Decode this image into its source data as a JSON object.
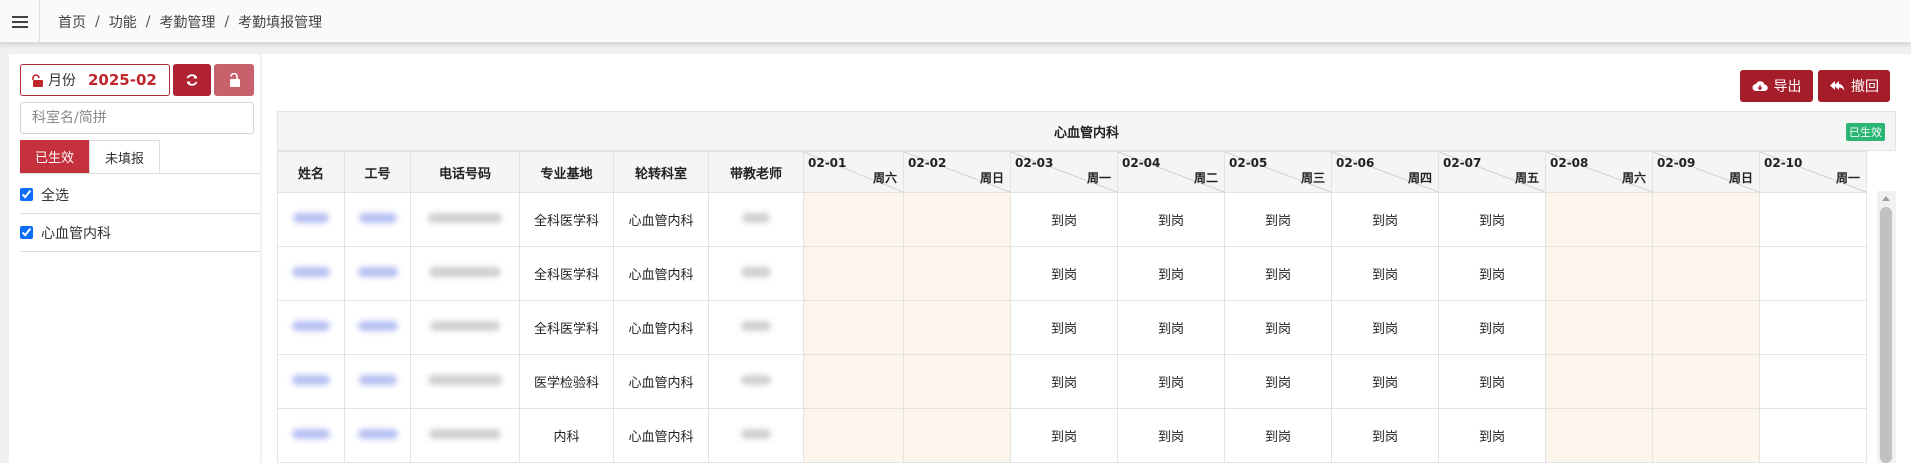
{
  "breadcrumb": [
    "首页",
    "功能",
    "考勤管理",
    "考勤填报管理"
  ],
  "filters": {
    "month_label": "月份",
    "month_value": "2025-02",
    "search_placeholder": "科室名/简拼",
    "tabs": [
      {
        "label": "已生效",
        "active": true
      },
      {
        "label": "未填报",
        "active": false
      }
    ],
    "dept_list": [
      {
        "label": "全选",
        "checked": true
      },
      {
        "label": "心血管内科",
        "checked": true
      }
    ]
  },
  "toolbar": {
    "export_label": "导出",
    "revoke_label": "撤回"
  },
  "table": {
    "title": "心血管内科",
    "status_badge": "已生效",
    "columns": [
      "姓名",
      "工号",
      "电话号码",
      "专业基地",
      "轮转科室",
      "带教老师"
    ],
    "dates": [
      {
        "date": "02-01",
        "weekday": "周六",
        "weekend": true
      },
      {
        "date": "02-02",
        "weekday": "周日",
        "weekend": true
      },
      {
        "date": "02-03",
        "weekday": "周一",
        "weekend": false
      },
      {
        "date": "02-04",
        "weekday": "周二",
        "weekend": false
      },
      {
        "date": "02-05",
        "weekday": "周三",
        "weekend": false
      },
      {
        "date": "02-06",
        "weekday": "周四",
        "weekend": false
      },
      {
        "date": "02-07",
        "weekday": "周五",
        "weekend": false
      },
      {
        "date": "02-08",
        "weekday": "周六",
        "weekend": true
      },
      {
        "date": "02-09",
        "weekday": "周日",
        "weekend": true
      },
      {
        "date": "02-10",
        "weekday": "周一",
        "weekend": false
      }
    ],
    "rows": [
      {
        "base": "全科医学科",
        "dept": "心血管内科",
        "attendance": [
          "",
          "",
          "到岗",
          "到岗",
          "到岗",
          "到岗",
          "到岗",
          "",
          "",
          ""
        ]
      },
      {
        "base": "全科医学科",
        "dept": "心血管内科",
        "attendance": [
          "",
          "",
          "到岗",
          "到岗",
          "到岗",
          "到岗",
          "到岗",
          "",
          "",
          ""
        ]
      },
      {
        "base": "全科医学科",
        "dept": "心血管内科",
        "attendance": [
          "",
          "",
          "到岗",
          "到岗",
          "到岗",
          "到岗",
          "到岗",
          "",
          "",
          ""
        ]
      },
      {
        "base": "医学检验科",
        "dept": "心血管内科",
        "attendance": [
          "",
          "",
          "到岗",
          "到岗",
          "到岗",
          "到岗",
          "到岗",
          "",
          "",
          ""
        ]
      },
      {
        "base": "内科",
        "dept": "心血管内科",
        "attendance": [
          "",
          "",
          "到岗",
          "到岗",
          "到岗",
          "到岗",
          "到岗",
          "",
          "",
          ""
        ]
      }
    ]
  },
  "colors": {
    "primary": "#a51d2a",
    "active_tab": "#c4303c",
    "weekend_bg": "#fdf5eb",
    "badge": "#2bb673"
  }
}
